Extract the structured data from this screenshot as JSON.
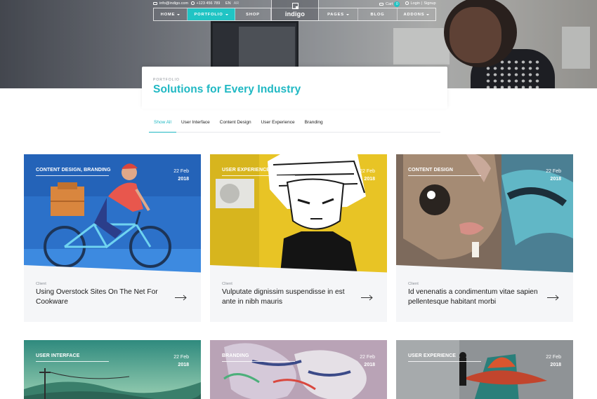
{
  "topbar": {
    "email": "info@indigo.com",
    "phone": "+123 456 789",
    "lang_active": "EN",
    "lang_other": "AR",
    "cart_label": "Cart",
    "cart_count": "0",
    "login_label": "Login",
    "signup_label": "Signup"
  },
  "nav": {
    "home": "Home",
    "portfolio": "Portfolio",
    "shop": "Shop",
    "logo": "indigo",
    "pages": "Pages",
    "blog": "Blog",
    "addons": "Addons"
  },
  "header": {
    "eyebrow": "Portfolio",
    "title": "Solutions for Every Industry"
  },
  "filters": [
    "Show All",
    "User Interface",
    "Content Design",
    "User Experience",
    "Branding"
  ],
  "cards": [
    {
      "category": "Content Design, Branding",
      "day": "22 Feb",
      "year": "2018",
      "client": "Client",
      "title": "Using Overstock Sites On The Net For Cookware"
    },
    {
      "category": "User Experience",
      "day": "22 Feb",
      "year": "2018",
      "client": "Client",
      "title": "Vulputate dignissim suspendisse in est ante in nibh mauris"
    },
    {
      "category": "Content Design",
      "day": "22 Feb",
      "year": "2018",
      "client": "Client",
      "title": "Id venenatis a condimentum vitae sapien pellentesque habitant morbi"
    },
    {
      "category": "User Interface",
      "day": "22 Feb",
      "year": "2018"
    },
    {
      "category": "Branding",
      "day": "22 Feb",
      "year": "2018"
    },
    {
      "category": "User Experience",
      "day": "22 Feb",
      "year": "2018"
    }
  ],
  "colors": {
    "accent": "#20c4c4",
    "title": "#1fb8c3"
  }
}
